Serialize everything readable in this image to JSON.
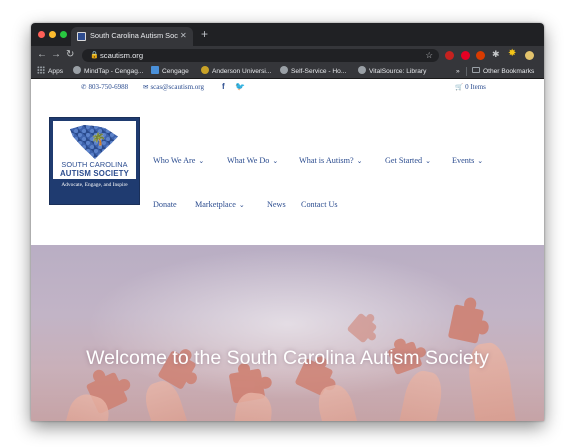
{
  "browser": {
    "tab": {
      "title": "South Carolina Autism Society",
      "close": "✕"
    },
    "new_tab": "+",
    "toolbar": {
      "back": "←",
      "forward": "→",
      "reload": "↻",
      "url": "scautism.org",
      "lock": "🔒",
      "bookmark_star": "☆"
    },
    "bookmarks": [
      {
        "label": "Apps",
        "icon": "apps-grid-icon"
      },
      {
        "label": "MindTap - Cengag...",
        "icon": "globe-icon"
      },
      {
        "label": "Cengage",
        "icon": "cengage-icon"
      },
      {
        "label": "Anderson Universi...",
        "icon": "anderson-icon"
      },
      {
        "label": "Self-Service - Ho...",
        "icon": "globe-icon"
      },
      {
        "label": "VitalSource: Library",
        "icon": "globe-icon"
      }
    ],
    "bookmarks_more": "»",
    "other_bookmarks": "Other Bookmarks",
    "extensions": [
      "lastpass-icon",
      "pinterest-icon",
      "office-icon",
      "puzzle-icon",
      "bug-icon",
      "profile-icon"
    ],
    "extension_glyphs": {
      "puzzle": "✱",
      "bug": "✸"
    }
  },
  "site": {
    "topbar": {
      "phone": "803-750-6988",
      "email": "scas@scautism.org",
      "facebook": "f",
      "twitter": "🐦",
      "cart": "0 Items",
      "phone_icon": "✆",
      "email_icon": "✉",
      "cart_icon": "🛒"
    },
    "logo": {
      "line1": "SOUTH CAROLINA",
      "line2": "AUTISM SOCIETY",
      "tagline": "Advocate, Engage, and Inspire",
      "palm": "🌴"
    },
    "nav": {
      "chevron": "⌄",
      "row1": [
        "Who We Are",
        "What We Do",
        "What is Autism?",
        "Get Started",
        "Events"
      ],
      "row2": [
        "Donate",
        "Marketplace",
        "News",
        "Contact Us"
      ]
    },
    "hero": {
      "title": "Welcome to the South Carolina Autism Society"
    }
  },
  "colors": {
    "brand_blue": "#2b4c8f",
    "logo_navy": "#1f3b70",
    "chrome_dark": "#202124",
    "chrome_toolbar": "#35363a",
    "hero_tint": "#c2b4c6"
  }
}
